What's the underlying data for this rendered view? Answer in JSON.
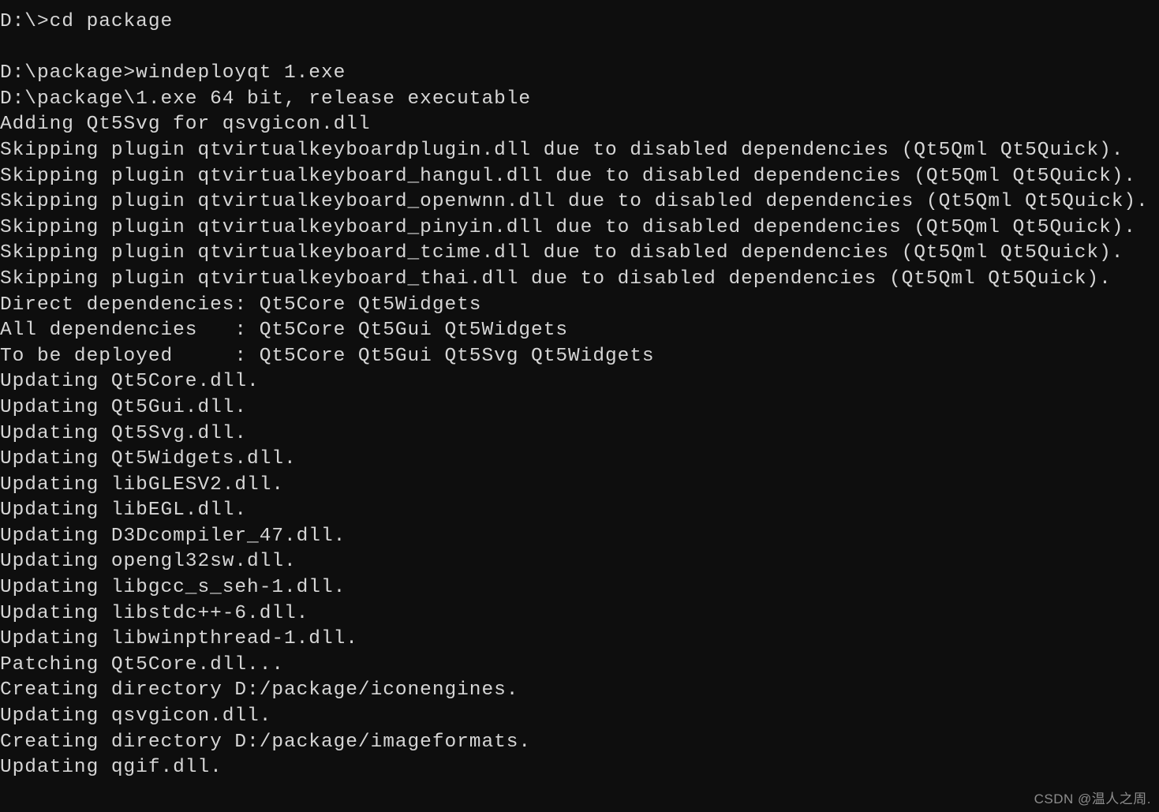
{
  "terminal": {
    "background_color": "#0e0e0e",
    "text_color": "#d6d6d6",
    "lines": [
      "D:\\>cd package",
      "",
      "D:\\package>windeployqt 1.exe",
      "D:\\package\\1.exe 64 bit, release executable",
      "Adding Qt5Svg for qsvgicon.dll",
      "Skipping plugin qtvirtualkeyboardplugin.dll due to disabled dependencies (Qt5Qml Qt5Quick).",
      "Skipping plugin qtvirtualkeyboard_hangul.dll due to disabled dependencies (Qt5Qml Qt5Quick).",
      "Skipping plugin qtvirtualkeyboard_openwnn.dll due to disabled dependencies (Qt5Qml Qt5Quick).",
      "Skipping plugin qtvirtualkeyboard_pinyin.dll due to disabled dependencies (Qt5Qml Qt5Quick).",
      "Skipping plugin qtvirtualkeyboard_tcime.dll due to disabled dependencies (Qt5Qml Qt5Quick).",
      "Skipping plugin qtvirtualkeyboard_thai.dll due to disabled dependencies (Qt5Qml Qt5Quick).",
      "Direct dependencies: Qt5Core Qt5Widgets",
      "All dependencies   : Qt5Core Qt5Gui Qt5Widgets",
      "To be deployed     : Qt5Core Qt5Gui Qt5Svg Qt5Widgets",
      "Updating Qt5Core.dll.",
      "Updating Qt5Gui.dll.",
      "Updating Qt5Svg.dll.",
      "Updating Qt5Widgets.dll.",
      "Updating libGLESV2.dll.",
      "Updating libEGL.dll.",
      "Updating D3Dcompiler_47.dll.",
      "Updating opengl32sw.dll.",
      "Updating libgcc_s_seh-1.dll.",
      "Updating libstdc++-6.dll.",
      "Updating libwinpthread-1.dll.",
      "Patching Qt5Core.dll...",
      "Creating directory D:/package/iconengines.",
      "Updating qsvgicon.dll.",
      "Creating directory D:/package/imageformats.",
      "Updating qgif.dll."
    ]
  },
  "watermark": {
    "text": "CSDN @温人之周.",
    "color": "#8d8d8d"
  }
}
